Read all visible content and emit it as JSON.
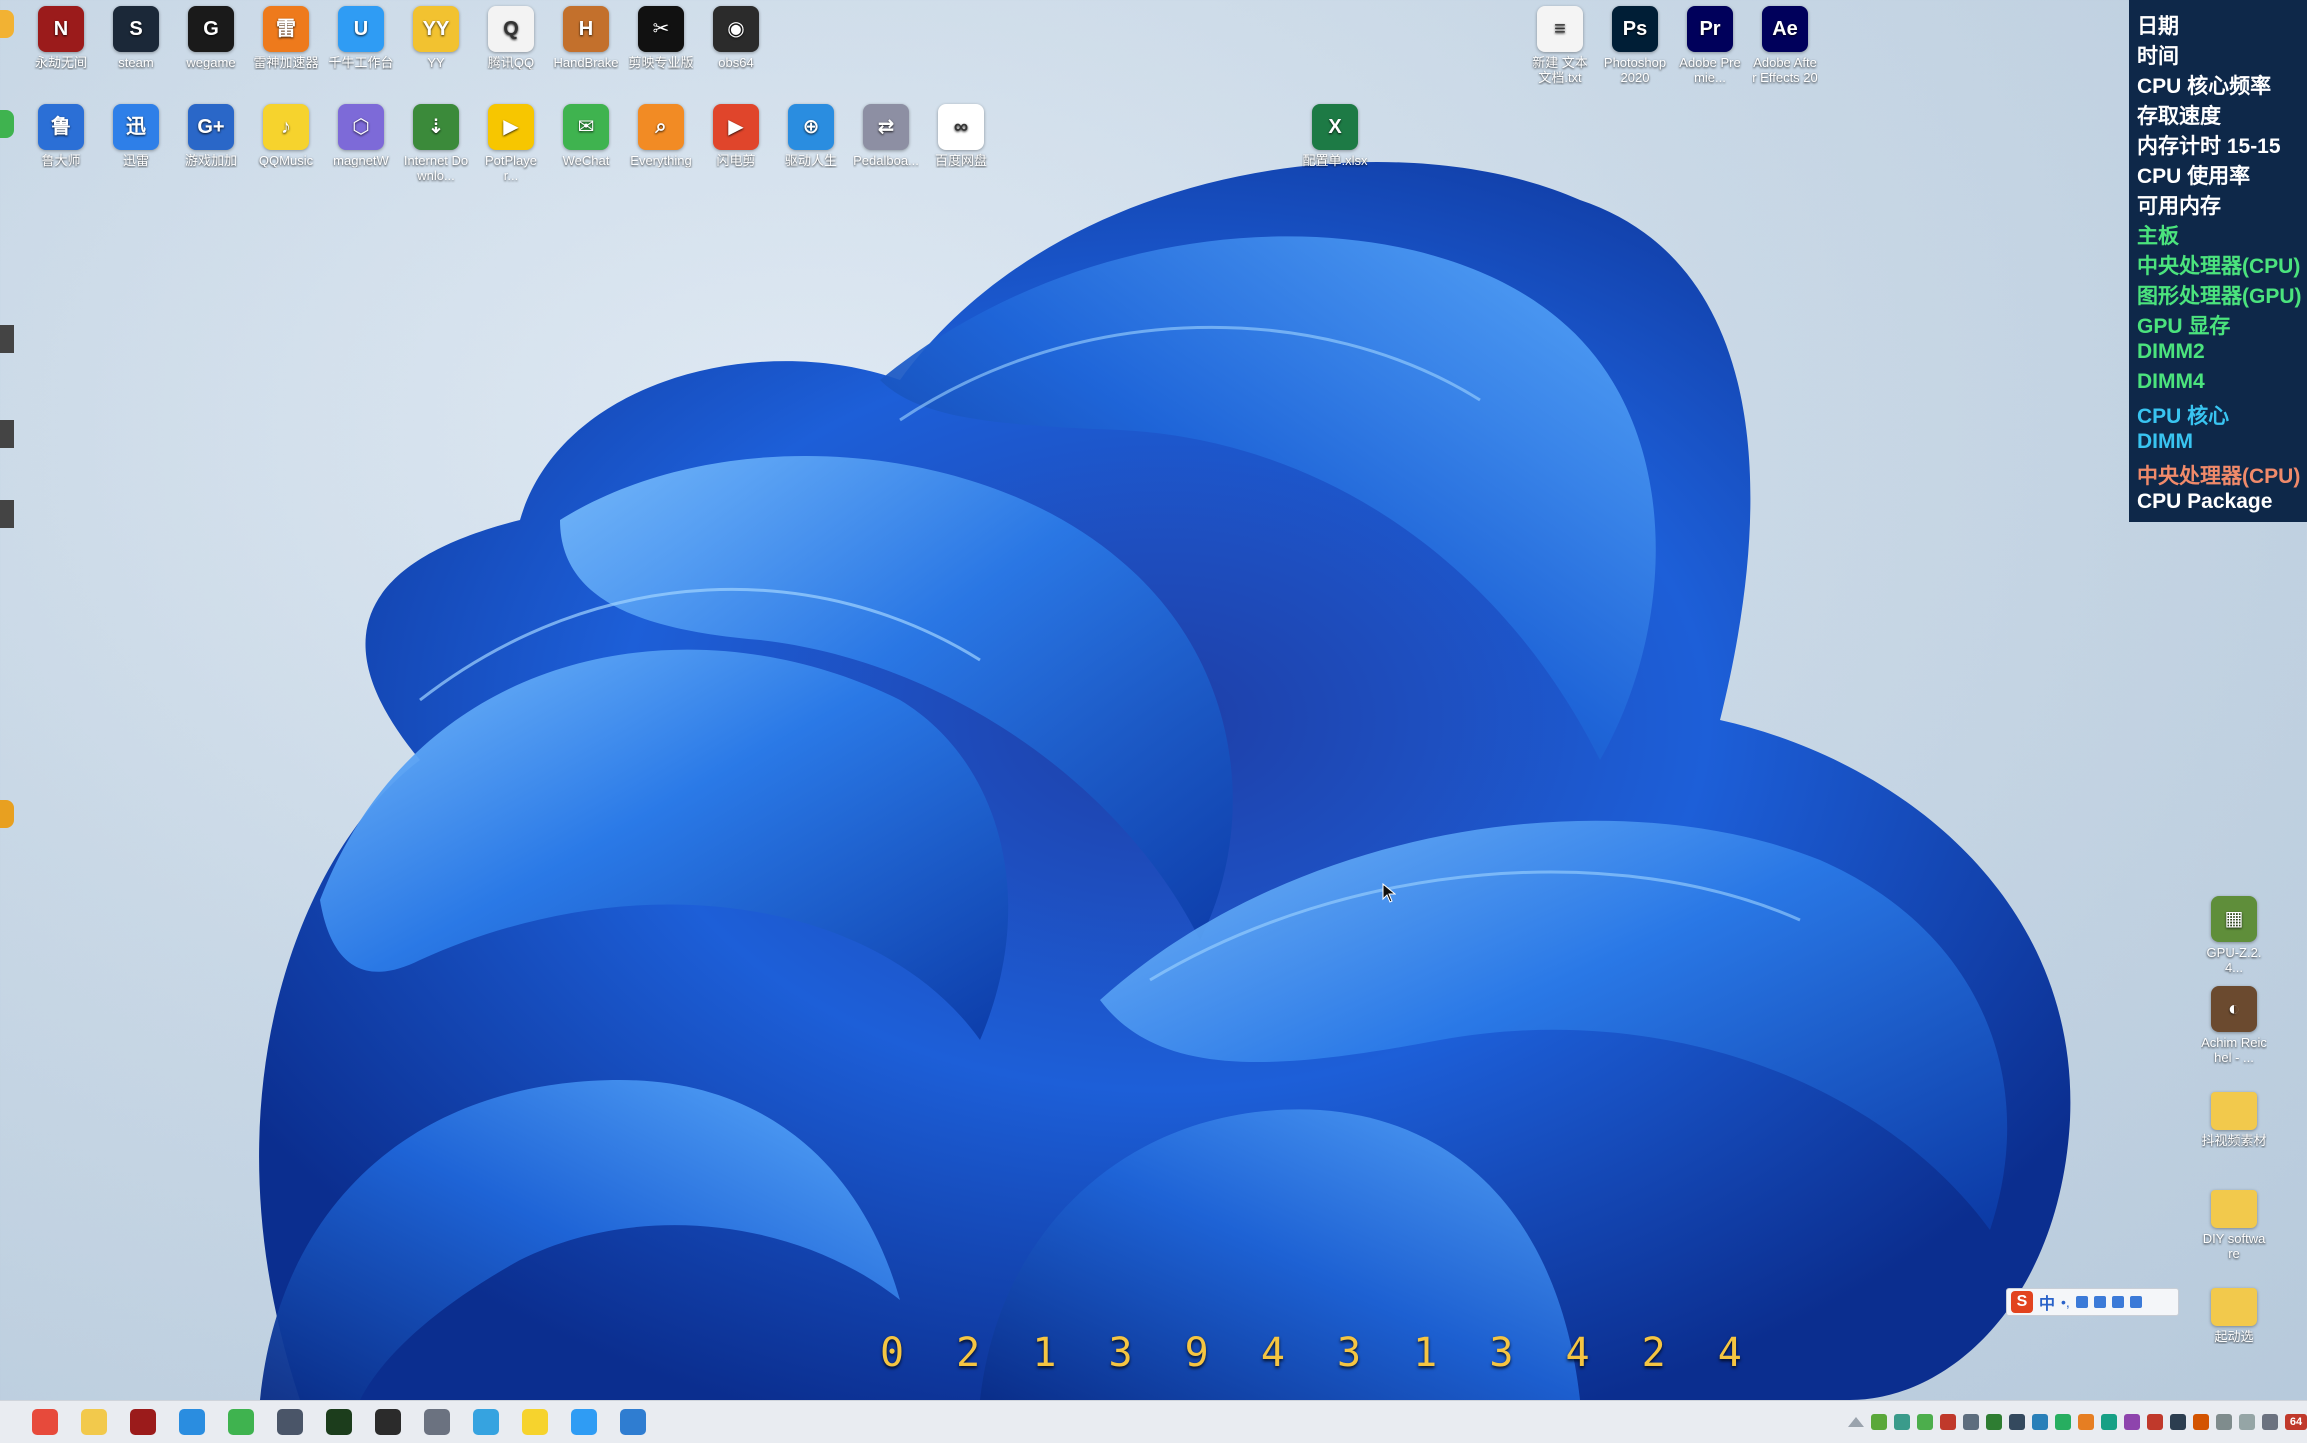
{
  "desktop": {
    "icons_row1": [
      {
        "label": "永劫无间",
        "icon": "naraka-icon",
        "color": "#9b1b1b",
        "glyph": "N"
      },
      {
        "label": "steam",
        "icon": "steam-icon",
        "color": "#1b2838",
        "glyph": "S"
      },
      {
        "label": "wegame",
        "icon": "wegame-icon",
        "color": "#1a1a1a",
        "glyph": "G"
      },
      {
        "label": "雷神加速器",
        "icon": "accelerator-icon",
        "color": "#ee7a1c",
        "glyph": "雷"
      },
      {
        "label": "千牛工作台",
        "icon": "qianniu-icon",
        "color": "#2f9cf4",
        "glyph": "U"
      },
      {
        "label": "YY",
        "icon": "yy-icon",
        "color": "#f2c230",
        "glyph": "YY"
      },
      {
        "label": "腾讯QQ",
        "icon": "qq-icon",
        "color": "#f3f3f3",
        "glyph": "Q"
      },
      {
        "label": "HandBrake",
        "icon": "handbrake-icon",
        "color": "#c3702c",
        "glyph": "H"
      },
      {
        "label": "剪映专业版",
        "icon": "capcut-icon",
        "color": "#111111",
        "glyph": "✂"
      },
      {
        "label": "obs64",
        "icon": "obs-icon",
        "color": "#2b2b2b",
        "glyph": "◉"
      }
    ],
    "icons_row2": [
      {
        "label": "鲁大师",
        "icon": "ludashi-icon",
        "color": "#2b6fd6",
        "glyph": "鲁"
      },
      {
        "label": "迅雷",
        "icon": "xunlei-icon",
        "color": "#2e7fe8",
        "glyph": "迅"
      },
      {
        "label": "游戏加加",
        "icon": "gameplus-icon",
        "color": "#2a67c8",
        "glyph": "G+"
      },
      {
        "label": "QQMusic",
        "icon": "qqmusic-icon",
        "color": "#f6d32d",
        "glyph": "♪"
      },
      {
        "label": "magnetW",
        "icon": "magnetw-icon",
        "color": "#7d6ad8",
        "glyph": "⬡"
      },
      {
        "label": "Internet Downlo...",
        "icon": "idm-icon",
        "color": "#3b8a3a",
        "glyph": "⇣"
      },
      {
        "label": "PotPlayer...",
        "icon": "potplayer-icon",
        "color": "#f7c600",
        "glyph": "▶"
      },
      {
        "label": "WeChat",
        "icon": "wechat-icon",
        "color": "#3fb34f",
        "glyph": "✉"
      },
      {
        "label": "Everything",
        "icon": "everything-icon",
        "color": "#f28b24",
        "glyph": "⌕"
      },
      {
        "label": "闪电剪",
        "icon": "video-editor-icon",
        "color": "#e0452b",
        "glyph": "▶"
      },
      {
        "label": "驱动人生",
        "icon": "driver-icon",
        "color": "#2a8de0",
        "glyph": "⊕"
      },
      {
        "label": "Pedalboa...",
        "icon": "pedalboard-icon",
        "color": "#8d8fa3",
        "glyph": "⇄"
      },
      {
        "label": "百度网盘",
        "icon": "baidu-netdisk-icon",
        "color": "#ffffff",
        "glyph": "∞"
      }
    ],
    "icons_top_right": [
      {
        "label": "新建 文本文档.txt",
        "icon": "text-file-icon",
        "color": "#f4f4f4",
        "glyph": "≡"
      },
      {
        "label": "Photoshop 2020",
        "icon": "photoshop-icon",
        "color": "#001e36",
        "glyph": "Ps"
      },
      {
        "label": "Adobe Premie...",
        "icon": "premiere-icon",
        "color": "#00005b",
        "glyph": "Pr"
      },
      {
        "label": "Adobe After Effects 2022",
        "icon": "after-effects-icon",
        "color": "#00005b",
        "glyph": "Ae"
      }
    ],
    "excel_file": {
      "label": "配置单.xlsx",
      "icon": "excel-file-icon",
      "color": "#1d7a45",
      "glyph": "X"
    },
    "icons_right_col": [
      {
        "label": "GPU-Z.2.4...",
        "icon": "gpuz-icon",
        "color": "#5f8e3a",
        "glyph": "▦"
      },
      {
        "label": "Achim Reichel - ...",
        "icon": "album-art-icon",
        "color": "#6b4a2f",
        "glyph": "◐"
      },
      {
        "label": "抖视频素材",
        "icon": "folder-icon",
        "color": "#f2c94c",
        "glyph": ""
      },
      {
        "label": "DIY software",
        "icon": "folder-icon",
        "color": "#f2c94c",
        "glyph": ""
      },
      {
        "label": "起动选",
        "icon": "folder-icon",
        "color": "#f2c94c",
        "glyph": ""
      }
    ]
  },
  "hw_panel": {
    "rows": [
      {
        "label": "日期",
        "color": "#ffffff"
      },
      {
        "label": "时间",
        "color": "#ffffff"
      },
      {
        "label": "CPU 核心频率",
        "color": "#ffffff"
      },
      {
        "label": "存取速度",
        "color": "#ffffff"
      },
      {
        "label": "内存计时  15-15",
        "color": "#ffffff"
      },
      {
        "label": "CPU 使用率",
        "color": "#ffffff"
      },
      {
        "label": "可用内存",
        "color": "#ffffff"
      },
      {
        "label": "主板",
        "color": "#4be37d"
      },
      {
        "label": "中央处理器(CPU)",
        "color": "#4be37d"
      },
      {
        "label": "图形处理器(GPU)",
        "color": "#4be37d"
      },
      {
        "label": "GPU 显存",
        "color": "#4be37d"
      },
      {
        "label": "DIMM2",
        "color": "#4be37d"
      },
      {
        "label": "DIMM4",
        "color": "#4be37d"
      },
      {
        "label": "CPU 核心",
        "color": "#39c4f0"
      },
      {
        "label": "DIMM",
        "color": "#39c4f0"
      },
      {
        "label": "中央处理器(CPU)",
        "color": "#f08a6a"
      },
      {
        "label": "CPU Package",
        "color": "#ffffff"
      }
    ]
  },
  "overlay": {
    "number": "0 2 1 3 9 4 3 1 3 4 2 4"
  },
  "ime": {
    "logo": "S",
    "mode": "中",
    "punct": "•,"
  },
  "taskbar": {
    "apps": [
      {
        "icon": "chrome-icon",
        "color": "#e74a3b"
      },
      {
        "icon": "file-explorer-icon",
        "color": "#f2c94c"
      },
      {
        "icon": "naraka-icon",
        "color": "#9b1b1b"
      },
      {
        "icon": "driver-icon",
        "color": "#2a8de0"
      },
      {
        "icon": "wechat-icon",
        "color": "#3fb34f"
      },
      {
        "icon": "calculator-icon",
        "color": "#4a5568"
      },
      {
        "icon": "terminal-icon",
        "color": "#1c3d1c"
      },
      {
        "icon": "obs-icon",
        "color": "#2b2b2b"
      },
      {
        "icon": "settings-icon",
        "color": "#6b7280"
      },
      {
        "icon": "network-icon",
        "color": "#36a3e0"
      },
      {
        "icon": "qqmusic-icon",
        "color": "#f6d32d"
      },
      {
        "icon": "qianniu-icon",
        "color": "#2f9cf4"
      },
      {
        "icon": "photos-icon",
        "color": "#2f7dd1"
      }
    ],
    "tray": [
      {
        "icon": "chevron-up-icon",
        "color": "#9aa3ad"
      },
      {
        "icon": "tray-app-icon",
        "color": "#5aa83a"
      },
      {
        "icon": "tray-app-icon",
        "color": "#3a9b8b"
      },
      {
        "icon": "tray-app-icon",
        "color": "#4cae4c"
      },
      {
        "icon": "tray-app-icon",
        "color": "#c0392b"
      },
      {
        "icon": "tray-app-icon",
        "color": "#5d6d7e"
      },
      {
        "icon": "tray-app-icon",
        "color": "#2e7d32"
      },
      {
        "icon": "tray-app-icon",
        "color": "#34495e"
      },
      {
        "icon": "tray-app-icon",
        "color": "#2980b9"
      },
      {
        "icon": "tray-app-icon",
        "color": "#27ae60"
      },
      {
        "icon": "tray-app-icon",
        "color": "#e67e22"
      },
      {
        "icon": "tray-app-icon",
        "color": "#16a085"
      },
      {
        "icon": "tray-app-icon",
        "color": "#8e44ad"
      },
      {
        "icon": "tray-app-icon",
        "color": "#c0392b"
      },
      {
        "icon": "tray-app-icon",
        "color": "#2c3e50"
      },
      {
        "icon": "tray-app-icon",
        "color": "#d35400"
      },
      {
        "icon": "tray-app-icon",
        "color": "#7f8c8d"
      },
      {
        "icon": "tray-app-icon",
        "color": "#95a5a6"
      },
      {
        "icon": "settings-icon",
        "color": "#6b7280"
      }
    ],
    "tray_badge": "64"
  }
}
